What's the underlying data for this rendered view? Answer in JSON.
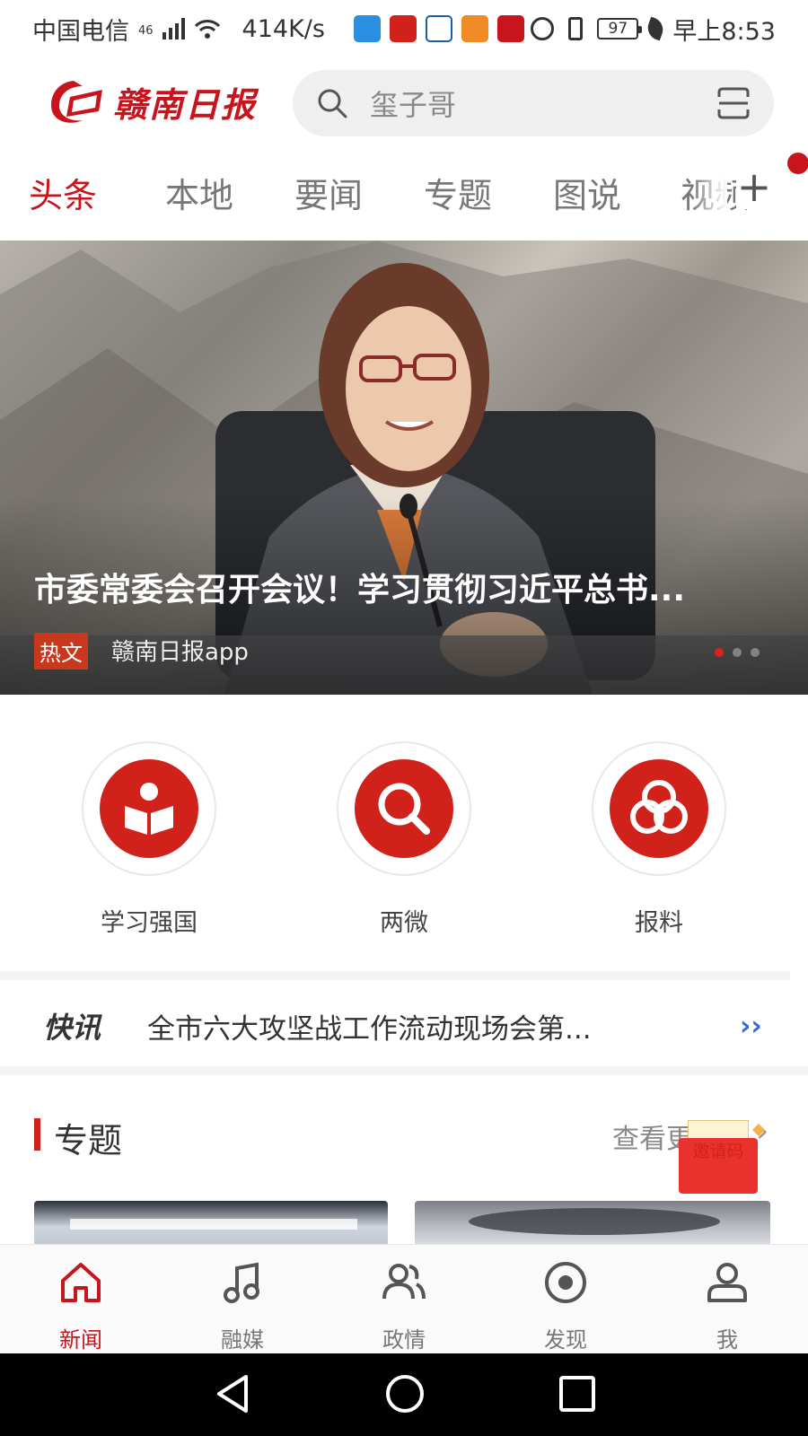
{
  "status_bar": {
    "carrier": "中国电信",
    "network": "46",
    "speed": "414K/s",
    "battery": "97",
    "time": "早上8:53"
  },
  "header": {
    "logo_text": "赣南日报",
    "search_placeholder": "玺子哥"
  },
  "tabs": [
    {
      "label": "头条",
      "active": true
    },
    {
      "label": "本地",
      "active": false
    },
    {
      "label": "要闻",
      "active": false
    },
    {
      "label": "专题",
      "active": false
    },
    {
      "label": "图说",
      "active": false
    },
    {
      "label": "视频",
      "active": false
    }
  ],
  "banner": {
    "title": "市委常委会召开会议！学习贯彻习近平总书...",
    "tag": "热文",
    "source": "赣南日报app"
  },
  "quick_actions": [
    {
      "label": "学习强国",
      "icon": "book-person-icon"
    },
    {
      "label": "两微",
      "icon": "search-icon"
    },
    {
      "label": "报料",
      "icon": "three-circles-icon"
    }
  ],
  "flash_news": {
    "tag": "快讯",
    "text": "全市六大攻坚战工作流动现场会第..."
  },
  "topics": {
    "title": "专题",
    "more": "查看更多",
    "invite": "邀请码"
  },
  "bottom_nav": [
    {
      "label": "新闻",
      "icon": "home-icon",
      "active": true
    },
    {
      "label": "融媒",
      "icon": "music-note-icon",
      "active": false
    },
    {
      "label": "政情",
      "icon": "people-icon",
      "active": false
    },
    {
      "label": "发现",
      "icon": "target-icon",
      "active": false
    },
    {
      "label": "我",
      "icon": "person-icon",
      "active": false
    }
  ],
  "colors": {
    "brand_red": "#c8151d",
    "icon_red": "#d0221b",
    "flash_arrow_blue": "#2c6ad8"
  }
}
